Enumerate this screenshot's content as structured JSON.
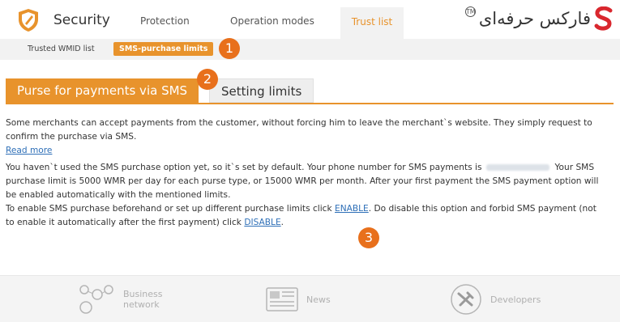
{
  "header": {
    "title": "Security",
    "tabs": [
      {
        "label": "Protection"
      },
      {
        "label": "Operation modes"
      },
      {
        "label": "Trust list",
        "active": true
      }
    ],
    "brand_text": "فارکس حرفه‌ای",
    "brand_badge": "TM"
  },
  "subnav": {
    "items": [
      {
        "label": "Trusted WMID list"
      },
      {
        "label": "SMS-purchase limits",
        "active": true
      }
    ]
  },
  "steps": [
    "1",
    "2",
    "3"
  ],
  "purse_tabs": {
    "active": "Purse for payments via SMS",
    "inactive": "Setting limits"
  },
  "content": {
    "intro_line1": "Some merchants can accept payments from the customer, without forcing him to leave the merchant`s website. They simply request to",
    "intro_line2": "confirm the purchase via SMS.",
    "read_more": "Read more",
    "status_line1_a": "You haven`t used the SMS purchase option yet, so it`s set by default. Your phone number for SMS payments is",
    "status_line1_b": "Your SMS",
    "status_line2": "purchase limit is 5000 WMR per day for each purse type, or 15000 WMR per month. After your first payment the SMS payment option will",
    "status_line3": "be enabled automatically with the mentioned limits.",
    "enable_line_a": "To enable SMS purchase beforehand or set up different purchase limits click",
    "enable_link": "ENABLE",
    "enable_line_b": ". Do disable this option and forbid SMS payment (not",
    "disable_line_a": "to enable it automatically after the first payment) click",
    "disable_link": "DISABLE",
    "disable_line_b": "."
  },
  "footer": {
    "items": [
      {
        "label_1": "Business",
        "label_2": "network",
        "icon": "people-network-icon"
      },
      {
        "label": "News",
        "icon": "newspaper-icon"
      },
      {
        "label": "Developers",
        "icon": "tools-icon"
      }
    ]
  },
  "colors": {
    "accent": "#e8932c",
    "badge": "#e8701c",
    "link": "#2e6fb7"
  }
}
